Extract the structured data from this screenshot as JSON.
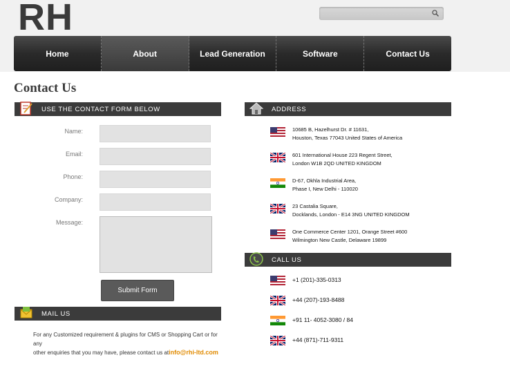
{
  "brand": {
    "logo": "RH"
  },
  "search": {
    "placeholder": ""
  },
  "nav": {
    "items": [
      "Home",
      "About",
      "Lead Generation",
      "Software",
      "Contact Us"
    ],
    "active": "About"
  },
  "page": {
    "title": "Contact Us"
  },
  "contact_form": {
    "header": "USE THE CONTACT FORM BELOW",
    "labels": {
      "name": "Name:",
      "email": "Email:",
      "phone": "Phone:",
      "company": "Company:",
      "message": "Message:"
    },
    "submit": "Submit Form"
  },
  "mail": {
    "header": "MAIL US",
    "line1": "For any Customized requirement & plugins for CMS or Shopping Cart or for any",
    "line2": "other enquiries that you may have, please contact us at",
    "email": "info@rhi-ltd.com"
  },
  "address": {
    "header": "ADDRESS",
    "entries": [
      {
        "flag": "us-flag",
        "line1": "10685 B, Hazelhurst Dr. # 11631,",
        "line2": "Houston, Texas 77043 United States of America"
      },
      {
        "flag": "uk-flag",
        "line1": "601 International House 223 Regent Street,",
        "line2": "London W1B 2QD UNITED KINGDOM"
      },
      {
        "flag": "india-flag",
        "line1": "D-67, Okhla Industrial Area,",
        "line2": "Phase I, New Delhi - 110020"
      },
      {
        "flag": "uk-flag",
        "line1": "23 Castalia Square,",
        "line2": "Docklands, London - E14 3NG UNITED KINGDOM"
      },
      {
        "flag": "us-flag",
        "line1": "One Commerce Center 1201, Orange Street #600",
        "line2": "Wilmington New Castle, Delaware 19899"
      }
    ]
  },
  "call": {
    "header": "CALL US",
    "numbers": [
      {
        "flag": "us-flag",
        "number": "+1 (201)-335-0313"
      },
      {
        "flag": "uk-flag",
        "number": "+44 (207)-193-8488"
      },
      {
        "flag": "india-flag",
        "number": "+91 11- 4052-3080 / 84"
      },
      {
        "flag": "uk-flag",
        "number": "+44 (871)-711-9311"
      }
    ]
  },
  "colors": {
    "header_bar": "#3b3b3b",
    "email": "#e08a00",
    "nav": "#2a2a2a"
  }
}
